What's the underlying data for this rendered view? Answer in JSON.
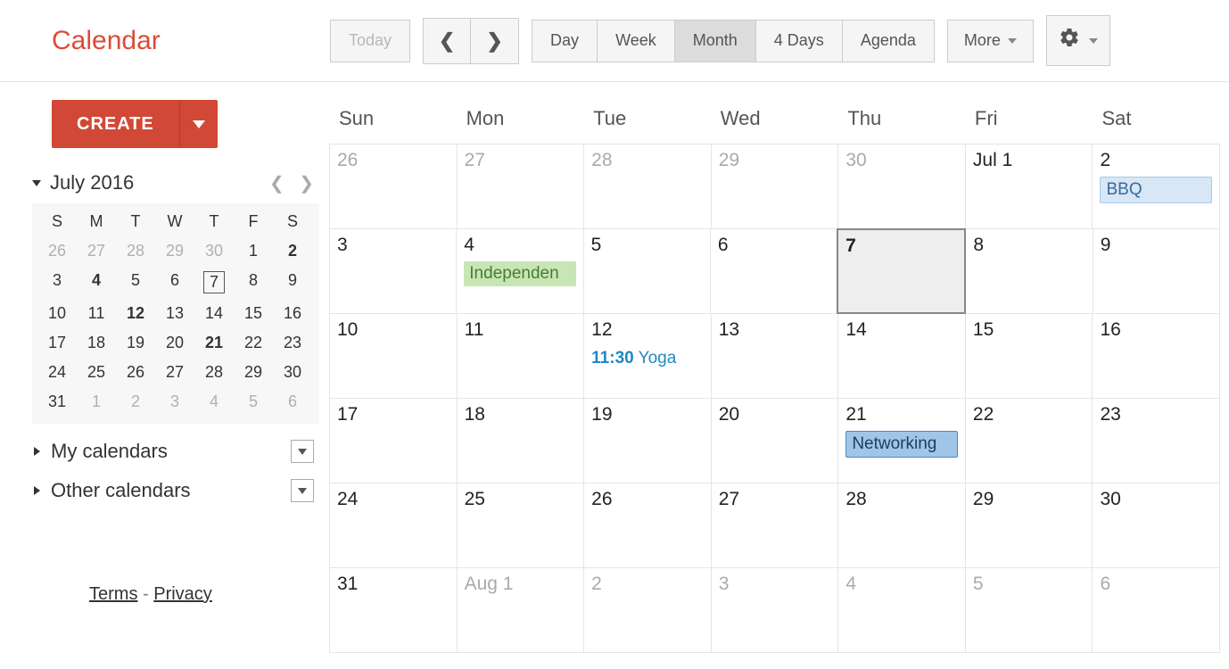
{
  "app": {
    "title": "Calendar"
  },
  "toolbar": {
    "today_label": "Today",
    "views": [
      "Day",
      "Week",
      "Month",
      "4 Days",
      "Agenda"
    ],
    "active_view_index": 2,
    "more_label": "More"
  },
  "sidebar": {
    "create_label": "CREATE",
    "mini": {
      "title": "July 2016",
      "dow": [
        "S",
        "M",
        "T",
        "W",
        "T",
        "F",
        "S"
      ],
      "weeks": [
        [
          {
            "n": 26,
            "other": true
          },
          {
            "n": 27,
            "other": true
          },
          {
            "n": 28,
            "other": true
          },
          {
            "n": 29,
            "other": true
          },
          {
            "n": 30,
            "other": true
          },
          {
            "n": 1
          },
          {
            "n": 2,
            "bold": true
          }
        ],
        [
          {
            "n": 3
          },
          {
            "n": 4,
            "bold": true
          },
          {
            "n": 5
          },
          {
            "n": 6
          },
          {
            "n": 7,
            "today": true
          },
          {
            "n": 8
          },
          {
            "n": 9
          }
        ],
        [
          {
            "n": 10
          },
          {
            "n": 11
          },
          {
            "n": 12,
            "bold": true
          },
          {
            "n": 13
          },
          {
            "n": 14
          },
          {
            "n": 15
          },
          {
            "n": 16
          }
        ],
        [
          {
            "n": 17
          },
          {
            "n": 18
          },
          {
            "n": 19
          },
          {
            "n": 20
          },
          {
            "n": 21,
            "bold": true
          },
          {
            "n": 22
          },
          {
            "n": 23
          }
        ],
        [
          {
            "n": 24
          },
          {
            "n": 25
          },
          {
            "n": 26
          },
          {
            "n": 27
          },
          {
            "n": 28
          },
          {
            "n": 29
          },
          {
            "n": 30
          }
        ],
        [
          {
            "n": 31
          },
          {
            "n": 1,
            "other": true
          },
          {
            "n": 2,
            "other": true
          },
          {
            "n": 3,
            "other": true
          },
          {
            "n": 4,
            "other": true
          },
          {
            "n": 5,
            "other": true
          },
          {
            "n": 6,
            "other": true
          }
        ]
      ]
    },
    "sections": [
      {
        "label": "My calendars"
      },
      {
        "label": "Other calendars"
      }
    ],
    "footer": {
      "terms": "Terms",
      "privacy": "Privacy"
    }
  },
  "calendar": {
    "dow": [
      "Sun",
      "Mon",
      "Tue",
      "Wed",
      "Thu",
      "Fri",
      "Sat"
    ],
    "weeks": [
      [
        {
          "label": "26",
          "other": true
        },
        {
          "label": "27",
          "other": true
        },
        {
          "label": "28",
          "other": true
        },
        {
          "label": "29",
          "other": true
        },
        {
          "label": "30",
          "other": true
        },
        {
          "label": "Jul 1"
        },
        {
          "label": "2",
          "events": [
            {
              "title": "BBQ",
              "style": "block-lightblue"
            }
          ]
        }
      ],
      [
        {
          "label": "3"
        },
        {
          "label": "4",
          "events": [
            {
              "title": "Independen",
              "style": "block-green"
            }
          ]
        },
        {
          "label": "5"
        },
        {
          "label": "6"
        },
        {
          "label": "7",
          "today": true
        },
        {
          "label": "8"
        },
        {
          "label": "9"
        }
      ],
      [
        {
          "label": "10"
        },
        {
          "label": "11"
        },
        {
          "label": "12",
          "events": [
            {
              "time": "11:30",
              "title": "Yoga",
              "style": "timed"
            }
          ]
        },
        {
          "label": "13"
        },
        {
          "label": "14"
        },
        {
          "label": "15"
        },
        {
          "label": "16"
        }
      ],
      [
        {
          "label": "17"
        },
        {
          "label": "18"
        },
        {
          "label": "19"
        },
        {
          "label": "20"
        },
        {
          "label": "21",
          "events": [
            {
              "title": "Networking",
              "style": "block-blue"
            }
          ]
        },
        {
          "label": "22"
        },
        {
          "label": "23"
        }
      ],
      [
        {
          "label": "24"
        },
        {
          "label": "25"
        },
        {
          "label": "26"
        },
        {
          "label": "27"
        },
        {
          "label": "28"
        },
        {
          "label": "29"
        },
        {
          "label": "30"
        }
      ],
      [
        {
          "label": "31"
        },
        {
          "label": "Aug 1",
          "other": true
        },
        {
          "label": "2",
          "other": true
        },
        {
          "label": "3",
          "other": true
        },
        {
          "label": "4",
          "other": true
        },
        {
          "label": "5",
          "other": true
        },
        {
          "label": "6",
          "other": true
        }
      ]
    ]
  }
}
